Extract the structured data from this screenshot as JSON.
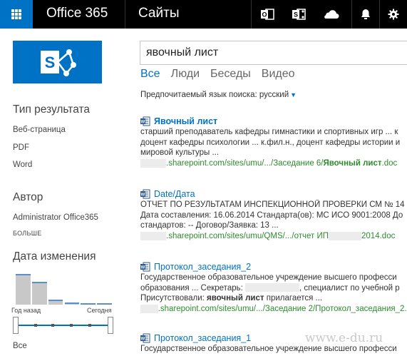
{
  "topbar": {
    "brand": "Office 365",
    "site": "Сайты",
    "icons": [
      "app-launcher-icon",
      "outlook-icon",
      "sharepoint-icon",
      "onedrive-icon",
      "notifications-bell-icon",
      "settings-gear-icon"
    ],
    "accent": "#0072c6",
    "bar_color": "#000000"
  },
  "search": {
    "query": "явочный лист",
    "tabs": [
      {
        "label": "Все",
        "active": true
      },
      {
        "label": "Люди",
        "active": false
      },
      {
        "label": "Беседы",
        "active": false
      },
      {
        "label": "Видео",
        "active": false
      }
    ],
    "language_label": "Предпочитаемый язык поиска:",
    "language_value": "русский"
  },
  "refiners": {
    "result_type": {
      "title": "Тип результата",
      "items": [
        "Веб-страница",
        "PDF",
        "Word"
      ]
    },
    "author": {
      "title": "Автор",
      "items": [
        "Administrator Office365"
      ],
      "more": "БОЛЬШЕ"
    },
    "modified": {
      "title": "Дата изменения",
      "histogram": [
        0.78,
        0.58,
        0.12,
        0.05,
        0.04,
        0.03
      ],
      "from_label": "Год назад",
      "to_label": "Сегодня",
      "all_label": "Все"
    }
  },
  "results": [
    {
      "title": "Явочный лист",
      "title_bold": true,
      "lines": [
        "старший преподаватель кафедры гимнастики и спортивных игр ... к",
        "доцент кафедры психологии ... к.фил.н., доцент кафедры истории и",
        "мировой культуры ..."
      ],
      "url_prefix": ".sharepoint.com/sites/umu/.../Заседание 6/",
      "url_bold": "Явочный лист",
      "url_suffix": ".doc"
    },
    {
      "title": "Date/Дата",
      "title_bold": false,
      "lines": [
        "ОТЧЕТ ПО РЕЗУЛЬТАТАМ ИНСПЕКЦИОННОЙ ПРОВЕРКИ СМ № 14",
        "Дата составления: 16.06.2014 Стандарта(ов): МС ИСО 9001:2008 До",
        "стандартов: -- Договор/Заявка: 13 ..."
      ],
      "url_prefix": ".sharepoint.com/sites/umu/QMS/.../отчет ИП",
      "url_suffix": "2014.doc"
    },
    {
      "title": "Протокол_заседания_2",
      "title_bold": false,
      "lines": [
        "Государственное образовательное учреждение высшего професси",
        "образования ... Секретарь:",
        "Присутствовали:"
      ],
      "line2_tail": ", специалист по учебной р",
      "line3_bold": "явочный лист",
      "line3_tail": "прилагается ...",
      "url_prefix": ".sharepoint.com/sites/umu/.../Заседание 2/Протокол_заседания_2.d"
    },
    {
      "title": "Протокол_заседания_1",
      "title_bold": false,
      "lines": [
        "Государственное образовательное учреждение высшего професси"
      ]
    }
  ],
  "watermark": "www.e-du.ru"
}
